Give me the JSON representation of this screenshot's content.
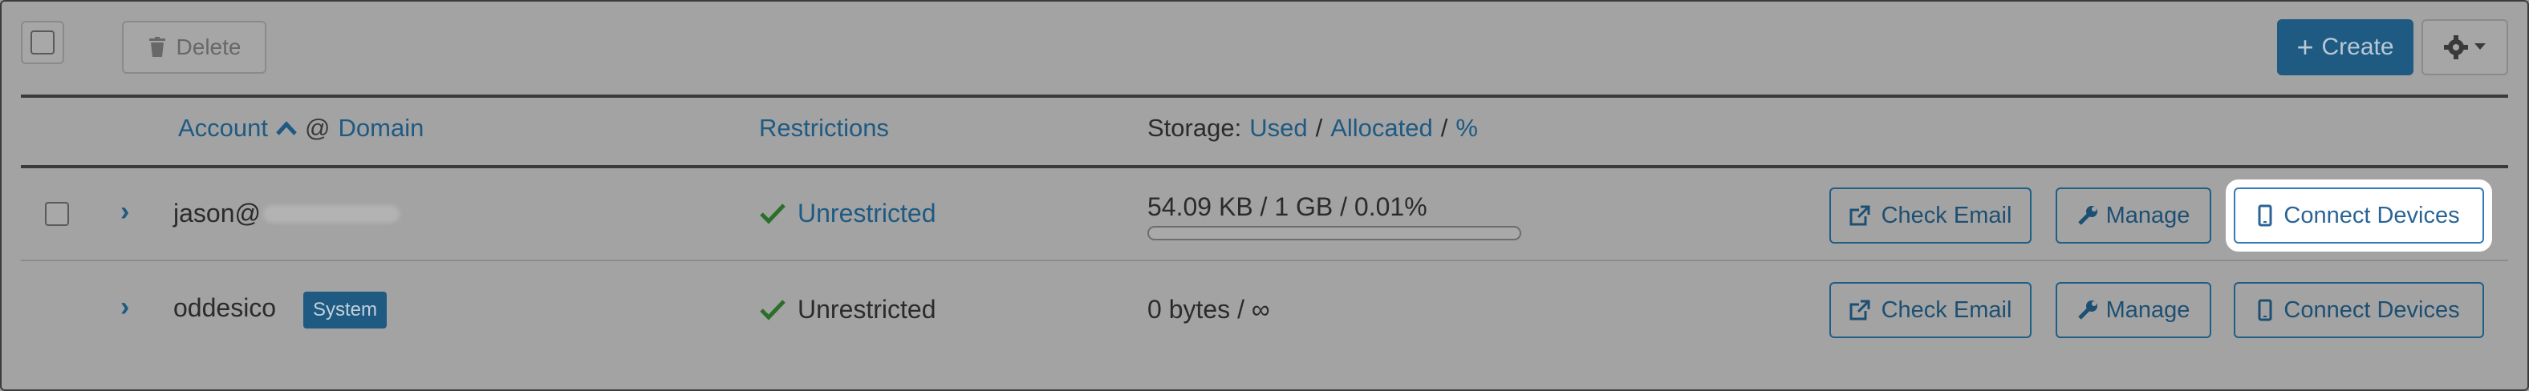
{
  "toolbar": {
    "delete_label": "Delete",
    "create_label": "Create"
  },
  "columns": {
    "account": "Account",
    "at": "@",
    "domain": "Domain",
    "restrictions": "Restrictions",
    "storage_prefix": "Storage:",
    "used": "Used",
    "slash1": "/",
    "allocated": "Allocated",
    "slash2": "/",
    "percent": "%"
  },
  "rows": [
    {
      "account": "jason@",
      "badge": "",
      "restriction": "Unrestricted",
      "storage": "54.09 KB / 1 GB / 0.01%",
      "usage_fraction": 0.0001,
      "actions": {
        "check_email": "Check Email",
        "manage": "Manage",
        "connect": "Connect Devices"
      }
    },
    {
      "account": "oddesico",
      "badge": "System",
      "restriction": "Unrestricted",
      "storage": "0 bytes / ∞",
      "actions": {
        "check_email": "Check Email",
        "manage": "Manage",
        "connect": "Connect Devices"
      }
    }
  ],
  "icons": {
    "trash": "trash-icon",
    "gear": "gear-icon",
    "caret": "caret-down-icon",
    "chevron": "chevron-right-icon",
    "check": "check-icon",
    "external": "external-link-icon",
    "wrench": "wrench-icon",
    "phone": "mobile-icon",
    "sort": "sort-asc-icon"
  },
  "colors": {
    "primary": "#337ab7",
    "link": "#1e5a82",
    "success": "#2c6e2c"
  }
}
